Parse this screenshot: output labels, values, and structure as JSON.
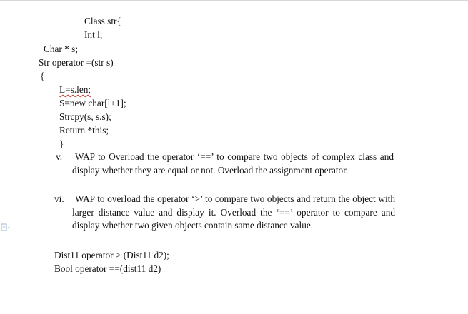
{
  "code": {
    "class_decl": "Class str{",
    "int_decl": "Int l;",
    "char_decl": "Char * s;",
    "op_sig": "Str operator =(str s)",
    "open_brace": "{",
    "body_1": "L=s.len;",
    "body_2": "S=new char[l+1];",
    "body_3": "Strcpy(s, s.s);",
    "body_4": "Return *this;",
    "close_brace": "}"
  },
  "questions": [
    {
      "number": "v.",
      "text": "WAP to Overload the operator ‘==’ to compare two objects of complex class and display whether they are equal or not. Overload the assignment operator."
    },
    {
      "number": "vi.",
      "text": "WAP to overload the operator ‘>’ to compare two objects and  return the object with larger distance value and display it. Overload the ‘==’ operator to compare and display whether two given objects contain same distance value."
    }
  ],
  "signatures": {
    "dist_gt": "Dist11 operator > (Dist11 d2);",
    "bool_eq": "Bool operator ==(dist11 d2)"
  },
  "colors": {
    "spell_error": "#c0392b",
    "grammar_error": "#2a4fb0",
    "gutter_icon": "#9fb7d6"
  }
}
